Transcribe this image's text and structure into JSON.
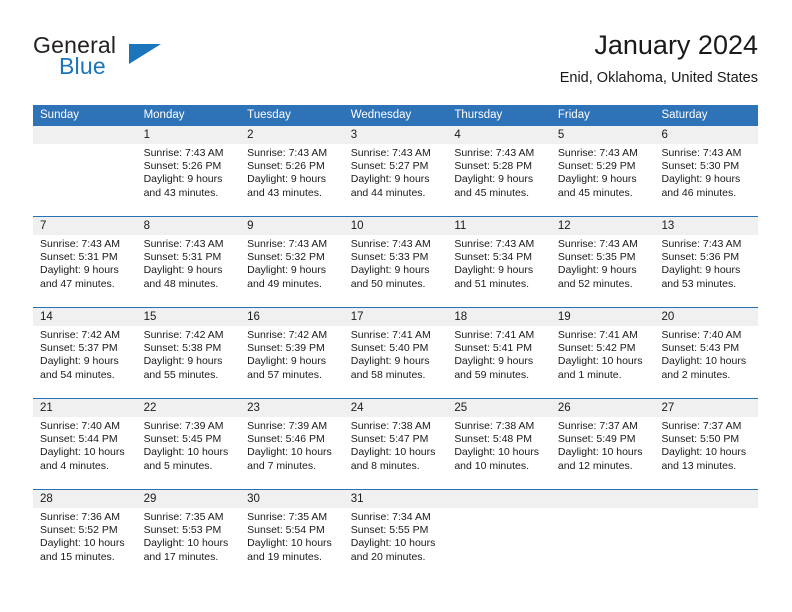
{
  "brand": {
    "name_part1": "General",
    "name_part2": "Blue",
    "logo_icon": "triangle-icon",
    "accent_color": "#1b75bb"
  },
  "header": {
    "title": "January 2024",
    "location": "Enid, Oklahoma, United States"
  },
  "theme": {
    "header_bg": "#2e72b8",
    "header_text": "#ffffff",
    "daynum_bg": "#f0f0f0",
    "row_rule": "#2a6eb4",
    "body_bg": "#ffffff",
    "text": "#1a1a1a"
  },
  "weekdays": [
    "Sunday",
    "Monday",
    "Tuesday",
    "Wednesday",
    "Thursday",
    "Friday",
    "Saturday"
  ],
  "weeks": [
    {
      "days": [
        {
          "num": "",
          "lines": [
            "",
            "",
            "",
            ""
          ],
          "empty": true
        },
        {
          "num": "1",
          "lines": [
            "Sunrise: 7:43 AM",
            "Sunset: 5:26 PM",
            "Daylight: 9 hours",
            "and 43 minutes."
          ]
        },
        {
          "num": "2",
          "lines": [
            "Sunrise: 7:43 AM",
            "Sunset: 5:26 PM",
            "Daylight: 9 hours",
            "and 43 minutes."
          ]
        },
        {
          "num": "3",
          "lines": [
            "Sunrise: 7:43 AM",
            "Sunset: 5:27 PM",
            "Daylight: 9 hours",
            "and 44 minutes."
          ]
        },
        {
          "num": "4",
          "lines": [
            "Sunrise: 7:43 AM",
            "Sunset: 5:28 PM",
            "Daylight: 9 hours",
            "and 45 minutes."
          ]
        },
        {
          "num": "5",
          "lines": [
            "Sunrise: 7:43 AM",
            "Sunset: 5:29 PM",
            "Daylight: 9 hours",
            "and 45 minutes."
          ]
        },
        {
          "num": "6",
          "lines": [
            "Sunrise: 7:43 AM",
            "Sunset: 5:30 PM",
            "Daylight: 9 hours",
            "and 46 minutes."
          ]
        }
      ]
    },
    {
      "days": [
        {
          "num": "7",
          "lines": [
            "Sunrise: 7:43 AM",
            "Sunset: 5:31 PM",
            "Daylight: 9 hours",
            "and 47 minutes."
          ]
        },
        {
          "num": "8",
          "lines": [
            "Sunrise: 7:43 AM",
            "Sunset: 5:31 PM",
            "Daylight: 9 hours",
            "and 48 minutes."
          ]
        },
        {
          "num": "9",
          "lines": [
            "Sunrise: 7:43 AM",
            "Sunset: 5:32 PM",
            "Daylight: 9 hours",
            "and 49 minutes."
          ]
        },
        {
          "num": "10",
          "lines": [
            "Sunrise: 7:43 AM",
            "Sunset: 5:33 PM",
            "Daylight: 9 hours",
            "and 50 minutes."
          ]
        },
        {
          "num": "11",
          "lines": [
            "Sunrise: 7:43 AM",
            "Sunset: 5:34 PM",
            "Daylight: 9 hours",
            "and 51 minutes."
          ]
        },
        {
          "num": "12",
          "lines": [
            "Sunrise: 7:43 AM",
            "Sunset: 5:35 PM",
            "Daylight: 9 hours",
            "and 52 minutes."
          ]
        },
        {
          "num": "13",
          "lines": [
            "Sunrise: 7:43 AM",
            "Sunset: 5:36 PM",
            "Daylight: 9 hours",
            "and 53 minutes."
          ]
        }
      ]
    },
    {
      "days": [
        {
          "num": "14",
          "lines": [
            "Sunrise: 7:42 AM",
            "Sunset: 5:37 PM",
            "Daylight: 9 hours",
            "and 54 minutes."
          ]
        },
        {
          "num": "15",
          "lines": [
            "Sunrise: 7:42 AM",
            "Sunset: 5:38 PM",
            "Daylight: 9 hours",
            "and 55 minutes."
          ]
        },
        {
          "num": "16",
          "lines": [
            "Sunrise: 7:42 AM",
            "Sunset: 5:39 PM",
            "Daylight: 9 hours",
            "and 57 minutes."
          ]
        },
        {
          "num": "17",
          "lines": [
            "Sunrise: 7:41 AM",
            "Sunset: 5:40 PM",
            "Daylight: 9 hours",
            "and 58 minutes."
          ]
        },
        {
          "num": "18",
          "lines": [
            "Sunrise: 7:41 AM",
            "Sunset: 5:41 PM",
            "Daylight: 9 hours",
            "and 59 minutes."
          ]
        },
        {
          "num": "19",
          "lines": [
            "Sunrise: 7:41 AM",
            "Sunset: 5:42 PM",
            "Daylight: 10 hours",
            "and 1 minute."
          ]
        },
        {
          "num": "20",
          "lines": [
            "Sunrise: 7:40 AM",
            "Sunset: 5:43 PM",
            "Daylight: 10 hours",
            "and 2 minutes."
          ]
        }
      ]
    },
    {
      "days": [
        {
          "num": "21",
          "lines": [
            "Sunrise: 7:40 AM",
            "Sunset: 5:44 PM",
            "Daylight: 10 hours",
            "and 4 minutes."
          ]
        },
        {
          "num": "22",
          "lines": [
            "Sunrise: 7:39 AM",
            "Sunset: 5:45 PM",
            "Daylight: 10 hours",
            "and 5 minutes."
          ]
        },
        {
          "num": "23",
          "lines": [
            "Sunrise: 7:39 AM",
            "Sunset: 5:46 PM",
            "Daylight: 10 hours",
            "and 7 minutes."
          ]
        },
        {
          "num": "24",
          "lines": [
            "Sunrise: 7:38 AM",
            "Sunset: 5:47 PM",
            "Daylight: 10 hours",
            "and 8 minutes."
          ]
        },
        {
          "num": "25",
          "lines": [
            "Sunrise: 7:38 AM",
            "Sunset: 5:48 PM",
            "Daylight: 10 hours",
            "and 10 minutes."
          ]
        },
        {
          "num": "26",
          "lines": [
            "Sunrise: 7:37 AM",
            "Sunset: 5:49 PM",
            "Daylight: 10 hours",
            "and 12 minutes."
          ]
        },
        {
          "num": "27",
          "lines": [
            "Sunrise: 7:37 AM",
            "Sunset: 5:50 PM",
            "Daylight: 10 hours",
            "and 13 minutes."
          ]
        }
      ]
    },
    {
      "days": [
        {
          "num": "28",
          "lines": [
            "Sunrise: 7:36 AM",
            "Sunset: 5:52 PM",
            "Daylight: 10 hours",
            "and 15 minutes."
          ]
        },
        {
          "num": "29",
          "lines": [
            "Sunrise: 7:35 AM",
            "Sunset: 5:53 PM",
            "Daylight: 10 hours",
            "and 17 minutes."
          ]
        },
        {
          "num": "30",
          "lines": [
            "Sunrise: 7:35 AM",
            "Sunset: 5:54 PM",
            "Daylight: 10 hours",
            "and 19 minutes."
          ]
        },
        {
          "num": "31",
          "lines": [
            "Sunrise: 7:34 AM",
            "Sunset: 5:55 PM",
            "Daylight: 10 hours",
            "and 20 minutes."
          ]
        },
        {
          "num": "",
          "lines": [
            "",
            "",
            "",
            ""
          ],
          "empty": true
        },
        {
          "num": "",
          "lines": [
            "",
            "",
            "",
            ""
          ],
          "empty": true
        },
        {
          "num": "",
          "lines": [
            "",
            "",
            "",
            ""
          ],
          "empty": true
        }
      ]
    }
  ]
}
